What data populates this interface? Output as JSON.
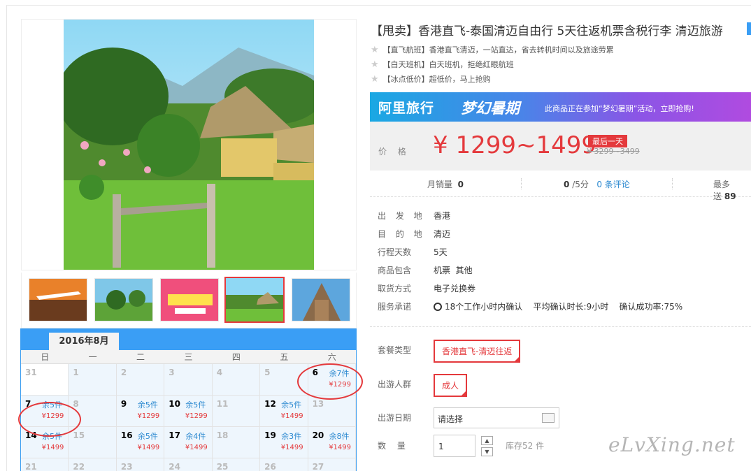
{
  "product": {
    "title": "【甩卖】香港直飞-泰国清迈自由行 5天往返机票含税行李 清迈旅游",
    "highlights": [
      "【直飞航班】香港直飞清迈，一站直达，省去转机时间以及旅途劳累",
      "【白天班机】白天班机，拒绝红眼航班",
      "【冰点低价】超低价，马上抢购"
    ]
  },
  "banner": {
    "brand": "阿里旅行",
    "campaign": "梦幻暑期",
    "text": "此商品正在参加“梦幻暑期”活动，立即抢购!"
  },
  "price": {
    "label": "价 格",
    "range": "¥ 1299~1499",
    "tag": "最后一天",
    "original": "¥ 3299~3499"
  },
  "stats": {
    "monthly_sales_label": "月销量",
    "monthly_sales": "0",
    "rating": "0",
    "rating_suffix": "/5分",
    "reviews": "0 条评论",
    "max_send_label": "最多送",
    "max_send": "89"
  },
  "attributes": [
    {
      "key": "出 发 地",
      "value": "香港"
    },
    {
      "key": "目 的 地",
      "value": "清迈"
    },
    {
      "key": "行程天数",
      "value": "5天"
    },
    {
      "key": "商品包含",
      "value": "机票  其他"
    },
    {
      "key": "取货方式",
      "value": "电子兑换券"
    },
    {
      "key": "服务承诺",
      "value": "18个工作小时内确认    平均确认时长:9小时    确认成功率:75%"
    }
  ],
  "options": {
    "package_label": "套餐类型",
    "package_value": "香港直飞-清迈往返",
    "crowd_label": "出游人群",
    "crowd_value": "成人",
    "date_label": "出游日期",
    "date_value": "请选择",
    "qty_label": "数  量",
    "qty_value": "1",
    "stock": "库存52 件"
  },
  "calendar": {
    "month": "2016年8月",
    "weekdays": [
      "日",
      "一",
      "二",
      "三",
      "四",
      "五",
      "六"
    ],
    "cells": [
      {
        "d": "31",
        "stock": "",
        "price": "",
        "active": false
      },
      {
        "d": "1",
        "stock": "",
        "price": "",
        "active": false
      },
      {
        "d": "2",
        "stock": "",
        "price": "",
        "active": false
      },
      {
        "d": "3",
        "stock": "",
        "price": "",
        "active": false
      },
      {
        "d": "4",
        "stock": "",
        "price": "",
        "active": false
      },
      {
        "d": "5",
        "stock": "",
        "price": "",
        "active": false
      },
      {
        "d": "6",
        "stock": "余7件",
        "price": "¥1299",
        "active": true
      },
      {
        "d": "7",
        "stock": "余5件",
        "price": "¥1299",
        "active": true
      },
      {
        "d": "8",
        "stock": "",
        "price": "",
        "active": false
      },
      {
        "d": "9",
        "stock": "余5件",
        "price": "¥1299",
        "active": true
      },
      {
        "d": "10",
        "stock": "余5件",
        "price": "¥1299",
        "active": true
      },
      {
        "d": "11",
        "stock": "",
        "price": "",
        "active": false
      },
      {
        "d": "12",
        "stock": "余5件",
        "price": "¥1499",
        "active": true
      },
      {
        "d": "13",
        "stock": "",
        "price": "",
        "active": false
      },
      {
        "d": "14",
        "stock": "余5件",
        "price": "¥1499",
        "active": true
      },
      {
        "d": "15",
        "stock": "",
        "price": "",
        "active": false
      },
      {
        "d": "16",
        "stock": "余5件",
        "price": "¥1499",
        "active": true
      },
      {
        "d": "17",
        "stock": "余4件",
        "price": "¥1499",
        "active": true
      },
      {
        "d": "18",
        "stock": "",
        "price": "",
        "active": false
      },
      {
        "d": "19",
        "stock": "余3件",
        "price": "¥1499",
        "active": true
      },
      {
        "d": "20",
        "stock": "余8件",
        "price": "¥1499",
        "active": true
      },
      {
        "d": "21",
        "stock": "",
        "price": "",
        "active": false
      },
      {
        "d": "22",
        "stock": "",
        "price": "",
        "active": false
      },
      {
        "d": "23",
        "stock": "",
        "price": "",
        "active": false
      },
      {
        "d": "24",
        "stock": "",
        "price": "",
        "active": false
      },
      {
        "d": "25",
        "stock": "",
        "price": "",
        "active": false
      },
      {
        "d": "26",
        "stock": "",
        "price": "",
        "active": false
      },
      {
        "d": "27",
        "stock": "",
        "price": "",
        "active": false
      }
    ]
  },
  "watermark": "eLvXing.net",
  "colors": {
    "accent": "#e4393c",
    "blue": "#3a9ef5"
  }
}
